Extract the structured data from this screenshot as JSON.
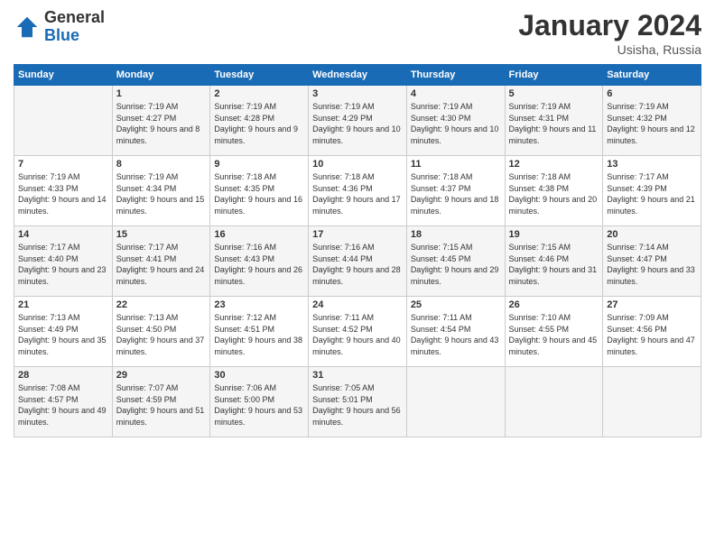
{
  "logo": {
    "general": "General",
    "blue": "Blue"
  },
  "header": {
    "title": "January 2024",
    "location": "Usisha, Russia"
  },
  "days_of_week": [
    "Sunday",
    "Monday",
    "Tuesday",
    "Wednesday",
    "Thursday",
    "Friday",
    "Saturday"
  ],
  "weeks": [
    [
      {
        "day": "",
        "sunrise": "",
        "sunset": "",
        "daylight": ""
      },
      {
        "day": "1",
        "sunrise": "Sunrise: 7:19 AM",
        "sunset": "Sunset: 4:27 PM",
        "daylight": "Daylight: 9 hours and 8 minutes."
      },
      {
        "day": "2",
        "sunrise": "Sunrise: 7:19 AM",
        "sunset": "Sunset: 4:28 PM",
        "daylight": "Daylight: 9 hours and 9 minutes."
      },
      {
        "day": "3",
        "sunrise": "Sunrise: 7:19 AM",
        "sunset": "Sunset: 4:29 PM",
        "daylight": "Daylight: 9 hours and 10 minutes."
      },
      {
        "day": "4",
        "sunrise": "Sunrise: 7:19 AM",
        "sunset": "Sunset: 4:30 PM",
        "daylight": "Daylight: 9 hours and 10 minutes."
      },
      {
        "day": "5",
        "sunrise": "Sunrise: 7:19 AM",
        "sunset": "Sunset: 4:31 PM",
        "daylight": "Daylight: 9 hours and 11 minutes."
      },
      {
        "day": "6",
        "sunrise": "Sunrise: 7:19 AM",
        "sunset": "Sunset: 4:32 PM",
        "daylight": "Daylight: 9 hours and 12 minutes."
      }
    ],
    [
      {
        "day": "7",
        "sunrise": "Sunrise: 7:19 AM",
        "sunset": "Sunset: 4:33 PM",
        "daylight": "Daylight: 9 hours and 14 minutes."
      },
      {
        "day": "8",
        "sunrise": "Sunrise: 7:19 AM",
        "sunset": "Sunset: 4:34 PM",
        "daylight": "Daylight: 9 hours and 15 minutes."
      },
      {
        "day": "9",
        "sunrise": "Sunrise: 7:18 AM",
        "sunset": "Sunset: 4:35 PM",
        "daylight": "Daylight: 9 hours and 16 minutes."
      },
      {
        "day": "10",
        "sunrise": "Sunrise: 7:18 AM",
        "sunset": "Sunset: 4:36 PM",
        "daylight": "Daylight: 9 hours and 17 minutes."
      },
      {
        "day": "11",
        "sunrise": "Sunrise: 7:18 AM",
        "sunset": "Sunset: 4:37 PM",
        "daylight": "Daylight: 9 hours and 18 minutes."
      },
      {
        "day": "12",
        "sunrise": "Sunrise: 7:18 AM",
        "sunset": "Sunset: 4:38 PM",
        "daylight": "Daylight: 9 hours and 20 minutes."
      },
      {
        "day": "13",
        "sunrise": "Sunrise: 7:17 AM",
        "sunset": "Sunset: 4:39 PM",
        "daylight": "Daylight: 9 hours and 21 minutes."
      }
    ],
    [
      {
        "day": "14",
        "sunrise": "Sunrise: 7:17 AM",
        "sunset": "Sunset: 4:40 PM",
        "daylight": "Daylight: 9 hours and 23 minutes."
      },
      {
        "day": "15",
        "sunrise": "Sunrise: 7:17 AM",
        "sunset": "Sunset: 4:41 PM",
        "daylight": "Daylight: 9 hours and 24 minutes."
      },
      {
        "day": "16",
        "sunrise": "Sunrise: 7:16 AM",
        "sunset": "Sunset: 4:43 PM",
        "daylight": "Daylight: 9 hours and 26 minutes."
      },
      {
        "day": "17",
        "sunrise": "Sunrise: 7:16 AM",
        "sunset": "Sunset: 4:44 PM",
        "daylight": "Daylight: 9 hours and 28 minutes."
      },
      {
        "day": "18",
        "sunrise": "Sunrise: 7:15 AM",
        "sunset": "Sunset: 4:45 PM",
        "daylight": "Daylight: 9 hours and 29 minutes."
      },
      {
        "day": "19",
        "sunrise": "Sunrise: 7:15 AM",
        "sunset": "Sunset: 4:46 PM",
        "daylight": "Daylight: 9 hours and 31 minutes."
      },
      {
        "day": "20",
        "sunrise": "Sunrise: 7:14 AM",
        "sunset": "Sunset: 4:47 PM",
        "daylight": "Daylight: 9 hours and 33 minutes."
      }
    ],
    [
      {
        "day": "21",
        "sunrise": "Sunrise: 7:13 AM",
        "sunset": "Sunset: 4:49 PM",
        "daylight": "Daylight: 9 hours and 35 minutes."
      },
      {
        "day": "22",
        "sunrise": "Sunrise: 7:13 AM",
        "sunset": "Sunset: 4:50 PM",
        "daylight": "Daylight: 9 hours and 37 minutes."
      },
      {
        "day": "23",
        "sunrise": "Sunrise: 7:12 AM",
        "sunset": "Sunset: 4:51 PM",
        "daylight": "Daylight: 9 hours and 38 minutes."
      },
      {
        "day": "24",
        "sunrise": "Sunrise: 7:11 AM",
        "sunset": "Sunset: 4:52 PM",
        "daylight": "Daylight: 9 hours and 40 minutes."
      },
      {
        "day": "25",
        "sunrise": "Sunrise: 7:11 AM",
        "sunset": "Sunset: 4:54 PM",
        "daylight": "Daylight: 9 hours and 43 minutes."
      },
      {
        "day": "26",
        "sunrise": "Sunrise: 7:10 AM",
        "sunset": "Sunset: 4:55 PM",
        "daylight": "Daylight: 9 hours and 45 minutes."
      },
      {
        "day": "27",
        "sunrise": "Sunrise: 7:09 AM",
        "sunset": "Sunset: 4:56 PM",
        "daylight": "Daylight: 9 hours and 47 minutes."
      }
    ],
    [
      {
        "day": "28",
        "sunrise": "Sunrise: 7:08 AM",
        "sunset": "Sunset: 4:57 PM",
        "daylight": "Daylight: 9 hours and 49 minutes."
      },
      {
        "day": "29",
        "sunrise": "Sunrise: 7:07 AM",
        "sunset": "Sunset: 4:59 PM",
        "daylight": "Daylight: 9 hours and 51 minutes."
      },
      {
        "day": "30",
        "sunrise": "Sunrise: 7:06 AM",
        "sunset": "Sunset: 5:00 PM",
        "daylight": "Daylight: 9 hours and 53 minutes."
      },
      {
        "day": "31",
        "sunrise": "Sunrise: 7:05 AM",
        "sunset": "Sunset: 5:01 PM",
        "daylight": "Daylight: 9 hours and 56 minutes."
      },
      {
        "day": "",
        "sunrise": "",
        "sunset": "",
        "daylight": ""
      },
      {
        "day": "",
        "sunrise": "",
        "sunset": "",
        "daylight": ""
      },
      {
        "day": "",
        "sunrise": "",
        "sunset": "",
        "daylight": ""
      }
    ]
  ]
}
